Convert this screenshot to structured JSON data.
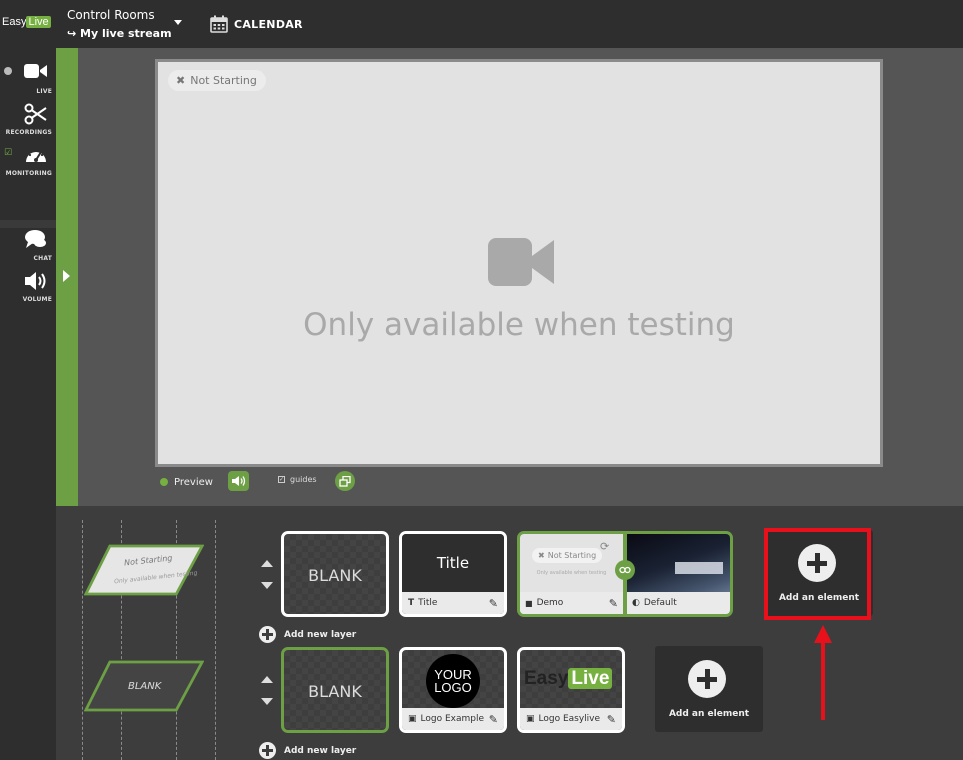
{
  "app": {
    "logo_text_1": "Easy",
    "logo_text_2": "Live"
  },
  "header": {
    "room_label": "Control Rooms",
    "room_name": "My live stream",
    "calendar_label": "CALENDAR"
  },
  "nav": {
    "items": [
      {
        "label": "LIVE",
        "icon": "video-camera-icon"
      },
      {
        "label": "RECORDINGS",
        "icon": "scissors-icon"
      },
      {
        "label": "MONITORING",
        "icon": "speedometer-icon"
      },
      {
        "label": "CHAT",
        "icon": "chat-icon"
      },
      {
        "label": "VOLUME",
        "icon": "volume-icon"
      }
    ]
  },
  "player": {
    "status": "Not Starting",
    "message": "Only available when testing"
  },
  "controls": {
    "preview_label": "Preview",
    "guides_label": "guides",
    "guides_checked": true
  },
  "layers": {
    "preview_top_status": "Not Starting",
    "preview_top_text": "Only available when testing",
    "preview_bottom_text": "BLANK",
    "layer1": {
      "blank_label": "BLANK",
      "title_tile": {
        "preview": "Title",
        "name": "Title"
      },
      "demo_tile": {
        "status": "Not Starting",
        "message": "Only available when testing",
        "name": "Demo"
      },
      "default_tile": {
        "name": "Default"
      },
      "add_element": "Add an element"
    },
    "layer2": {
      "blank_label": "BLANK",
      "logo_example": {
        "preview_line1": "YOUR",
        "preview_line2": "LOGO",
        "name": "Logo Example"
      },
      "logo_easylive": {
        "preview_1": "Easy",
        "preview_2": "Live",
        "name": "Logo Easylive"
      },
      "add_element": "Add an element"
    },
    "add_layer_1": "Add new layer",
    "add_layer_2": "Add new layer"
  },
  "colors": {
    "accent_green": "#6d9f45",
    "highlight_red": "#e8111b"
  }
}
